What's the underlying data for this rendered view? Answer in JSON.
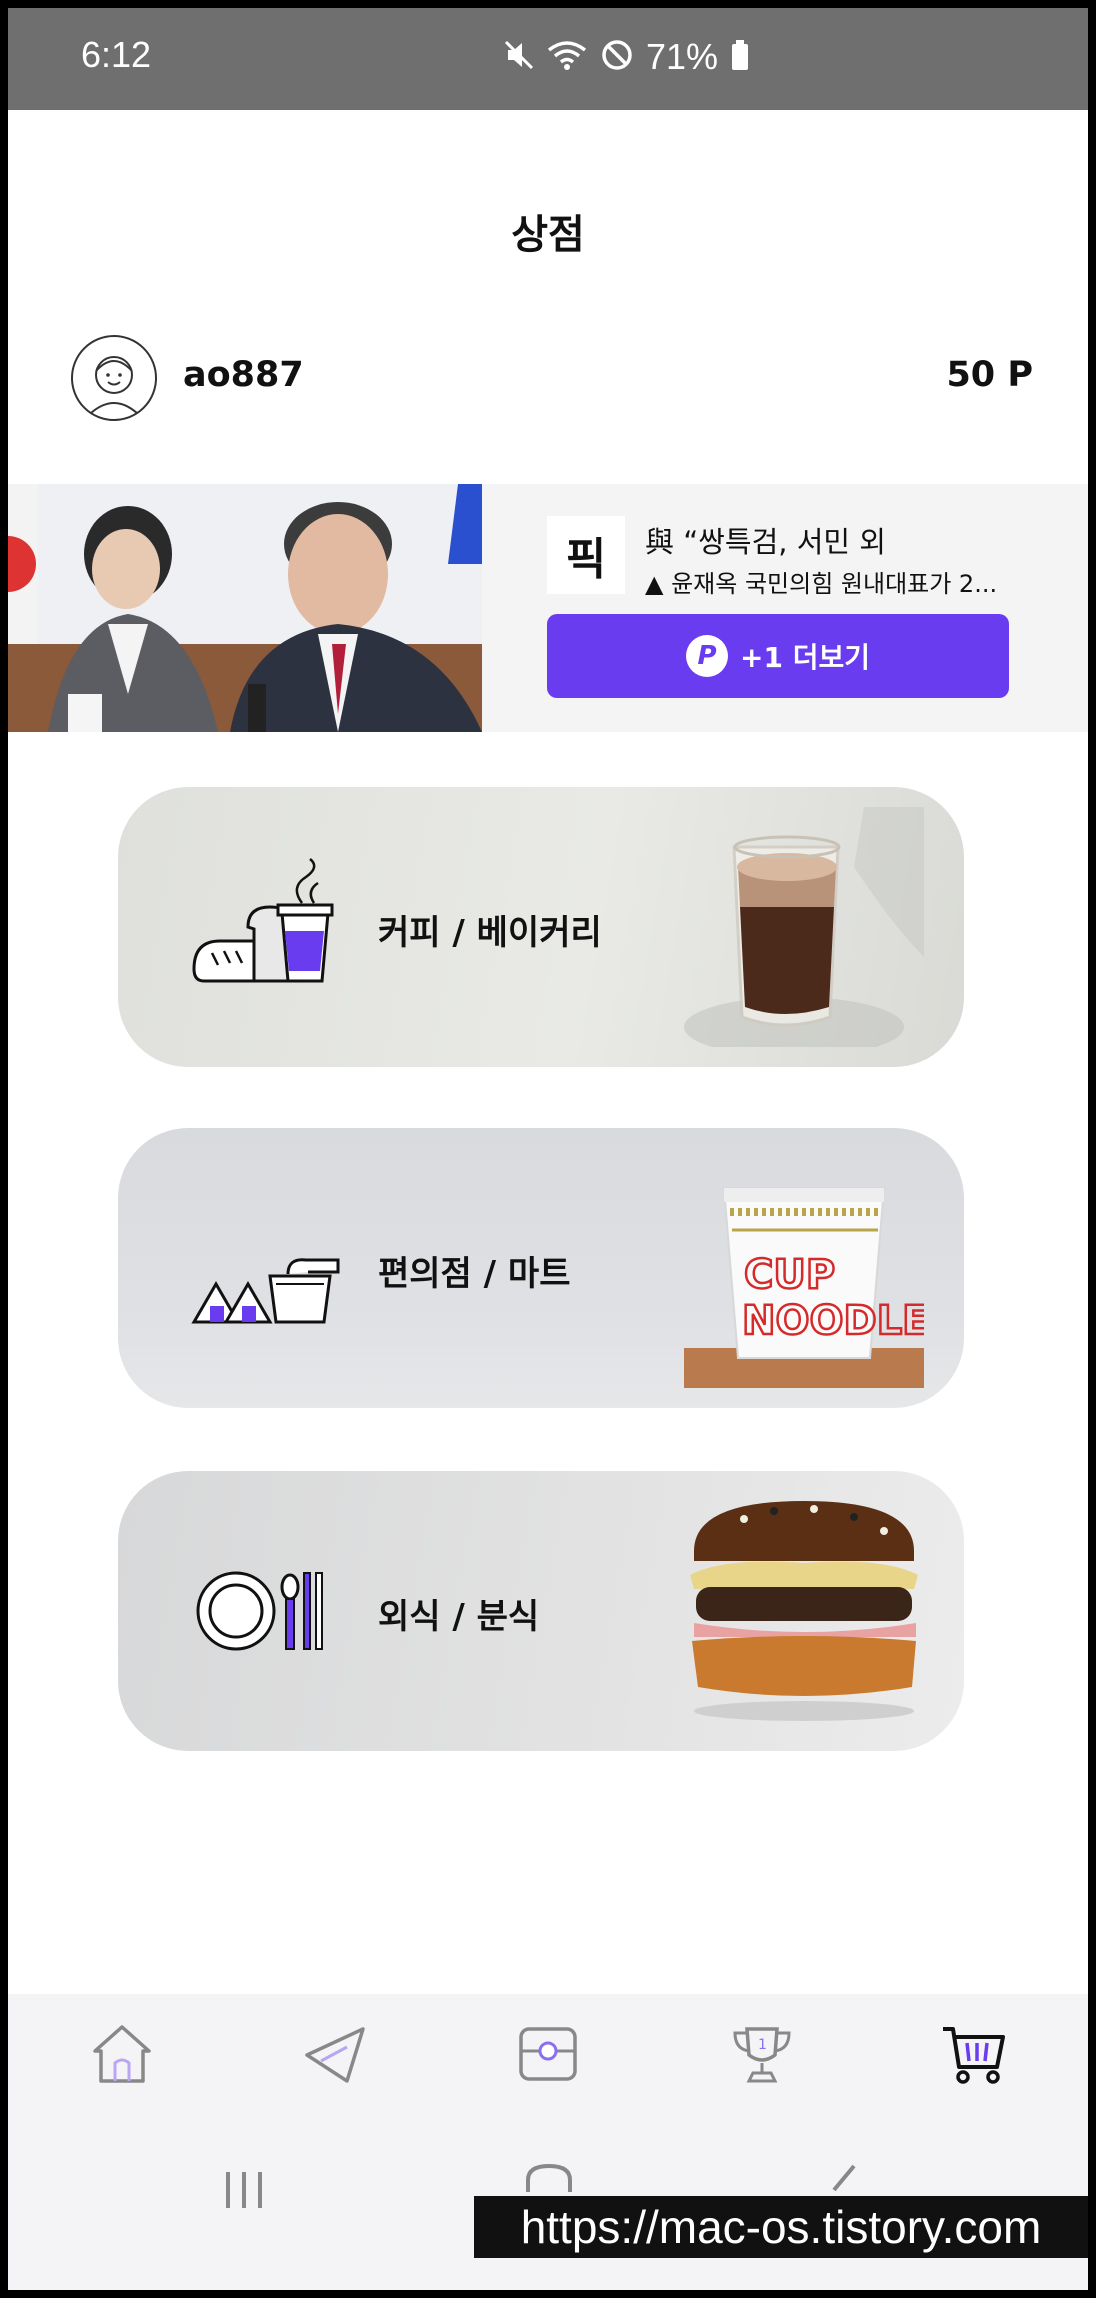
{
  "status_bar": {
    "time": "6:12",
    "battery": "71%"
  },
  "header": {
    "title": "상점"
  },
  "profile": {
    "username": "ao887",
    "points": "50 P"
  },
  "news": {
    "logo": "픽",
    "headline": "與 “쌍특검, 서민 외",
    "subline": "▲ 윤재옥 국민의힘 원내대표가 2...",
    "more_label": "+1 더보기",
    "badge": "P"
  },
  "categories": [
    {
      "label": "커피 / 베이커리"
    },
    {
      "label": "편의점 / 마트"
    },
    {
      "label": "외식 / 분식"
    }
  ],
  "bottom_nav": [
    {
      "icon": "home-icon"
    },
    {
      "icon": "paper-plane-icon"
    },
    {
      "icon": "box-icon"
    },
    {
      "icon": "trophy-icon"
    },
    {
      "icon": "cart-icon"
    }
  ],
  "watermark": "https://mac-os.tistory.com",
  "colors": {
    "accent": "#6a3cf0",
    "status_bar": "#6f6f6f",
    "nav_bg": "#f4f4f6"
  }
}
